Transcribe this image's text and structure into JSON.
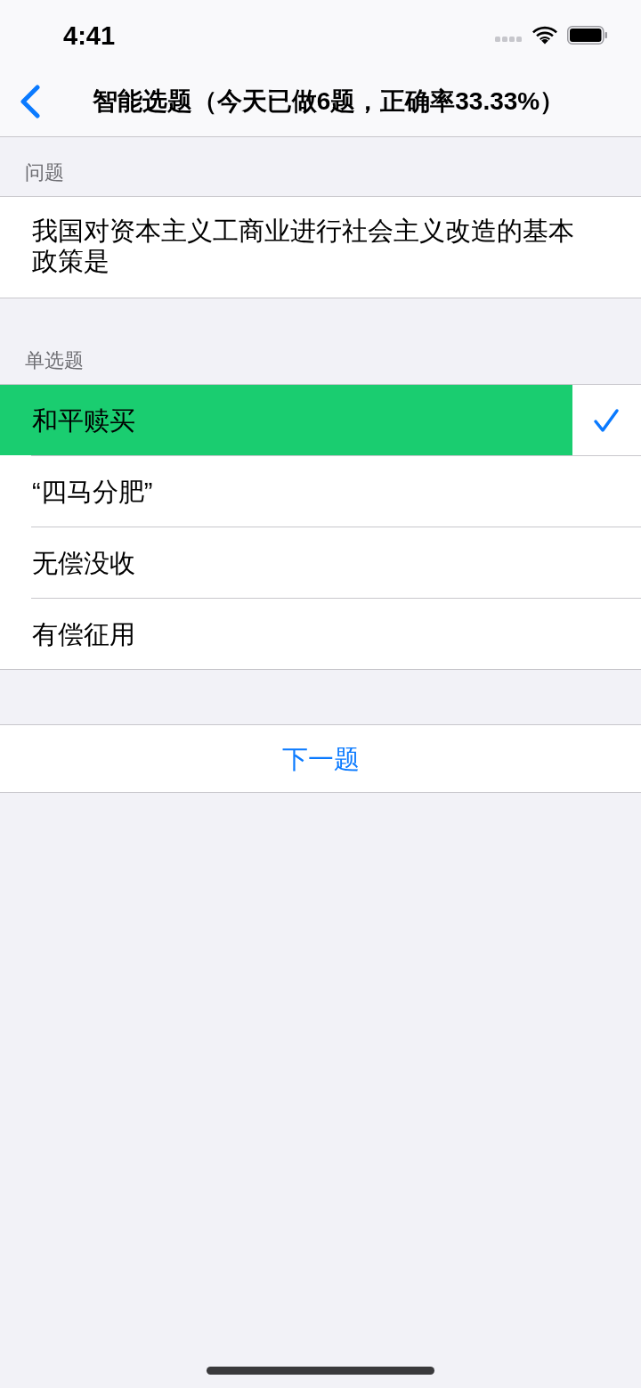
{
  "status_bar": {
    "time": "4:41"
  },
  "nav_bar": {
    "title": "智能选题（今天已做6题，正确率33.33%）"
  },
  "question_section": {
    "header": "问题",
    "text": "我国对资本主义工商业进行社会主义改造的基本政策是"
  },
  "options_section": {
    "header": "单选题",
    "options": [
      {
        "label": "和平赎买",
        "selected": true
      },
      {
        "label": "“四马分肥”",
        "selected": false
      },
      {
        "label": "无偿没收",
        "selected": false
      },
      {
        "label": "有偿征用",
        "selected": false
      }
    ]
  },
  "next_button": {
    "label": "下一题"
  }
}
